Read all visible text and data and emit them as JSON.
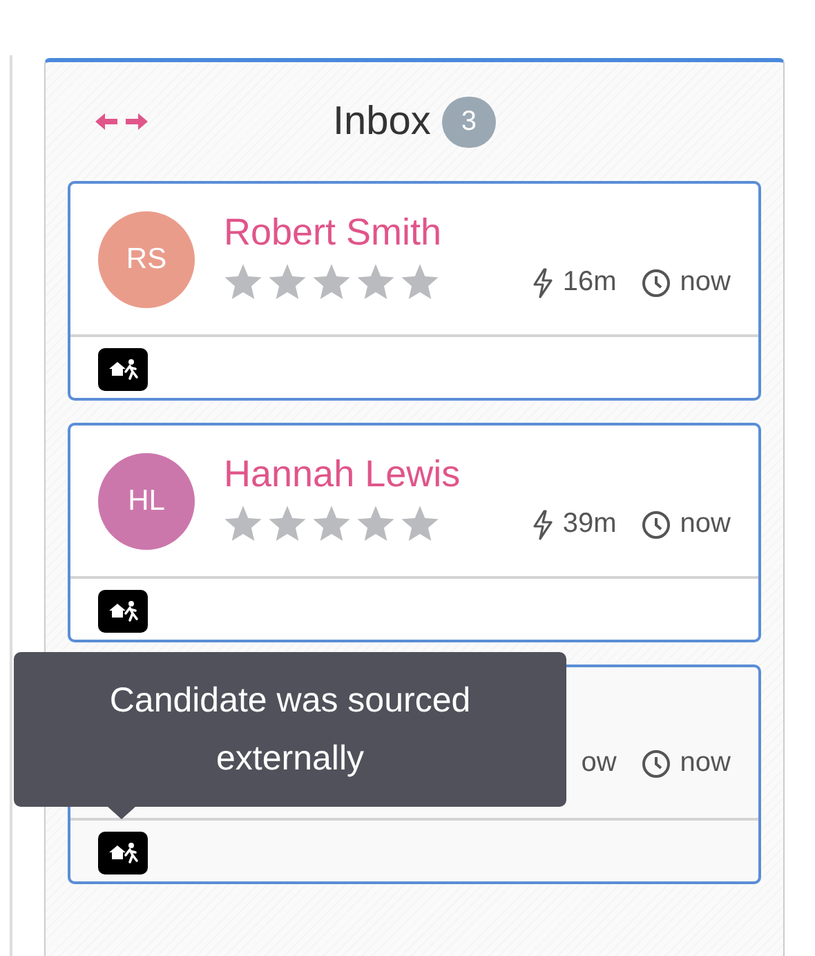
{
  "column": {
    "title": "Inbox",
    "count": "3"
  },
  "cards": [
    {
      "initials": "RS",
      "color": "#ea9c8b",
      "name": "Robert Smith",
      "stars": 0,
      "reading": "16m",
      "time": "now"
    },
    {
      "initials": "HL",
      "color": "#cc77ab",
      "name": "Hannah Lewis",
      "stars": 0,
      "reading": "39m",
      "time": "now"
    },
    {
      "reading": "ow",
      "time": "now"
    }
  ],
  "tooltip": {
    "text": "Candidate was sourced externally"
  }
}
